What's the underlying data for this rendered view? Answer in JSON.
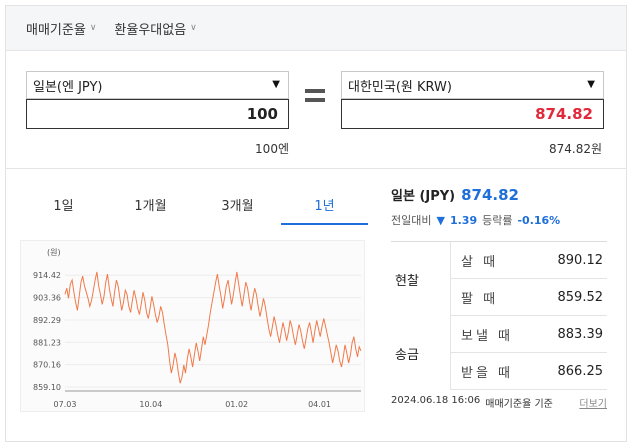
{
  "topbar": {
    "rate_type": "매매기준율",
    "discount": "환율우대없음"
  },
  "calculator": {
    "from_currency": "일본(엔 JPY)",
    "from_amount": "100",
    "from_words": "100엔",
    "equals_icon": "equals-icon",
    "to_currency": "대한민국(원 KRW)",
    "to_amount": "874.82",
    "to_words": "874.82원",
    "to_amount_color": "#e0293a"
  },
  "tabs": [
    {
      "label": "1일"
    },
    {
      "label": "1개월"
    },
    {
      "label": "3개월"
    },
    {
      "label": "1년"
    }
  ],
  "active_tab": 3,
  "summary": {
    "name": "일본 (JPY)",
    "value": "874.82",
    "change_label": "전일대비",
    "change_value": "1.39",
    "change_dir_icon": "down-triangle-icon",
    "pct_label": "등락률",
    "pct_value": "-0.16%"
  },
  "table": {
    "cash_label": "현찰",
    "remit_label": "송금",
    "buy_label": "살 때",
    "buy_value": "890.12",
    "sell_label": "팔 때",
    "sell_value": "859.52",
    "send_label": "보낼 때",
    "send_value": "883.39",
    "receive_label": "받을 때",
    "receive_value": "866.25"
  },
  "footer": {
    "timestamp": "2024.06.18 16:06",
    "basis": "매매기준율 기준",
    "more": "더보기"
  },
  "chart_data": {
    "type": "line",
    "unit": "(원)",
    "ylim": [
      859.1,
      917.5
    ],
    "yticks": [
      "914.42",
      "903.36",
      "892.29",
      "881.23",
      "870.16",
      "859.10"
    ],
    "xticks": [
      "07.03",
      "10.04",
      "01.02",
      "04.01"
    ],
    "color": "#f07a4a",
    "values": [
      905,
      908,
      903,
      910,
      912,
      906,
      901,
      897,
      904,
      911,
      914,
      909,
      906,
      903,
      899,
      902,
      907,
      912,
      916,
      909,
      905,
      900,
      904,
      911,
      915,
      908,
      903,
      899,
      906,
      912,
      909,
      903,
      897,
      901,
      907,
      905,
      899,
      896,
      902,
      907,
      903,
      898,
      895,
      900,
      906,
      902,
      896,
      893,
      898,
      904,
      900,
      895,
      891,
      894,
      899,
      896,
      890,
      885,
      880,
      872,
      866,
      870,
      876,
      872,
      866,
      861,
      864,
      870,
      866,
      873,
      878,
      874,
      869,
      875,
      881,
      877,
      872,
      878,
      884,
      880,
      885,
      890,
      896,
      901,
      906,
      911,
      915,
      909,
      904,
      898,
      903,
      909,
      912,
      906,
      900,
      905,
      911,
      916,
      910,
      904,
      899,
      905,
      911,
      908,
      902,
      897,
      903,
      908,
      905,
      899,
      894,
      898,
      903,
      899,
      893,
      888,
      884,
      889,
      894,
      890,
      885,
      881,
      886,
      891,
      887,
      882,
      886,
      892,
      889,
      884,
      880,
      885,
      890,
      887,
      882,
      878,
      883,
      888,
      891,
      886,
      881,
      887,
      892,
      888,
      884,
      889,
      893,
      889,
      885,
      881,
      876,
      871,
      875,
      880,
      877,
      872,
      869,
      874,
      880,
      876,
      871,
      875,
      881,
      884,
      878,
      874,
      879,
      877
    ]
  }
}
